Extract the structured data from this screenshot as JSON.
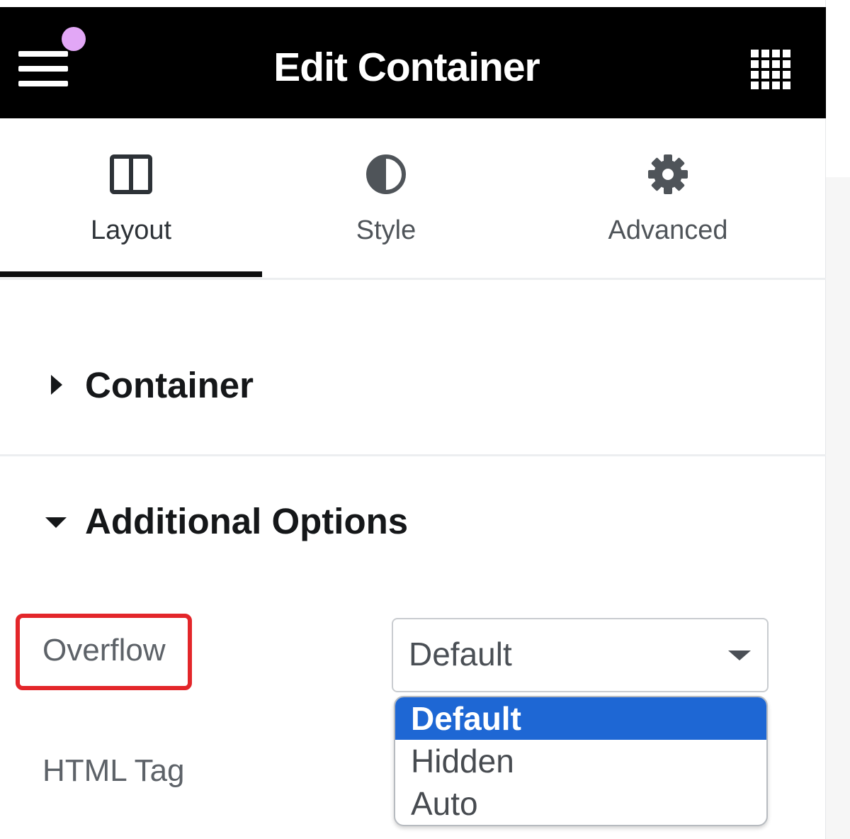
{
  "header": {
    "title": "Edit Container",
    "menu_icon": "hamburger-menu-icon",
    "apps_icon": "grid-apps-icon",
    "notification_color": "#e2a7f6"
  },
  "tabs": [
    {
      "label": "Layout",
      "icon": "columns-layout-icon",
      "active": true
    },
    {
      "label": "Style",
      "icon": "half-circle-contrast-icon",
      "active": false
    },
    {
      "label": "Advanced",
      "icon": "gear-icon",
      "active": false
    }
  ],
  "sections": {
    "container": {
      "title": "Container",
      "expanded": false
    },
    "additional": {
      "title": "Additional Options",
      "expanded": true
    }
  },
  "controls": {
    "overflow": {
      "label": "Overflow",
      "value": "Default",
      "options": [
        "Default",
        "Hidden",
        "Auto"
      ],
      "selected_index": 0
    },
    "html_tag": {
      "label": "HTML Tag"
    }
  },
  "colors": {
    "header_bg": "#000000",
    "highlight": "#e3262a",
    "selection": "#1e67d4"
  }
}
